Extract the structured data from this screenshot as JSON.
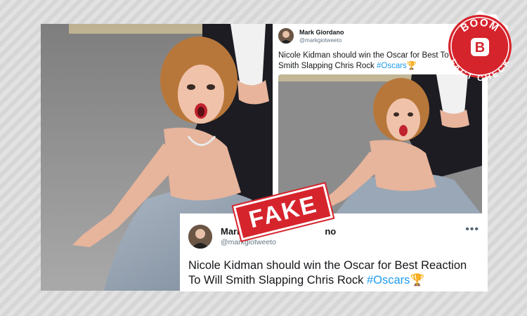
{
  "colors": {
    "accent_red": "#d6242d",
    "hashtag_blue": "#1d9bf0",
    "handle_gray": "#657786",
    "text_dark": "#14171a"
  },
  "photo_large": {
    "description_icon": "photo-icon"
  },
  "tweet_small": {
    "display_name": "Mark Giordano",
    "handle": "@markgiotweeto",
    "text_before": "Nicole Kidman should win the Oscar for Best To Will Smith Slapping Chris Rock ",
    "hashtag": "#Oscars",
    "emoji": "🏆"
  },
  "tweet_large": {
    "display_name_visible": "Mark",
    "display_name_tail": "no",
    "handle": "@markgiotweeto",
    "more_label": "•••",
    "text_line1": "Nicole Kidman should win the Oscar for Best Reaction",
    "text_line2_before": "To Will Smith Slapping Chris Rock ",
    "hashtag": "#Oscars",
    "emoji": "🏆"
  },
  "stamp": {
    "label": "FAKE"
  },
  "badge": {
    "top_text": "BOOM",
    "letter": "B",
    "bottom_text": "FACT CHECK"
  }
}
